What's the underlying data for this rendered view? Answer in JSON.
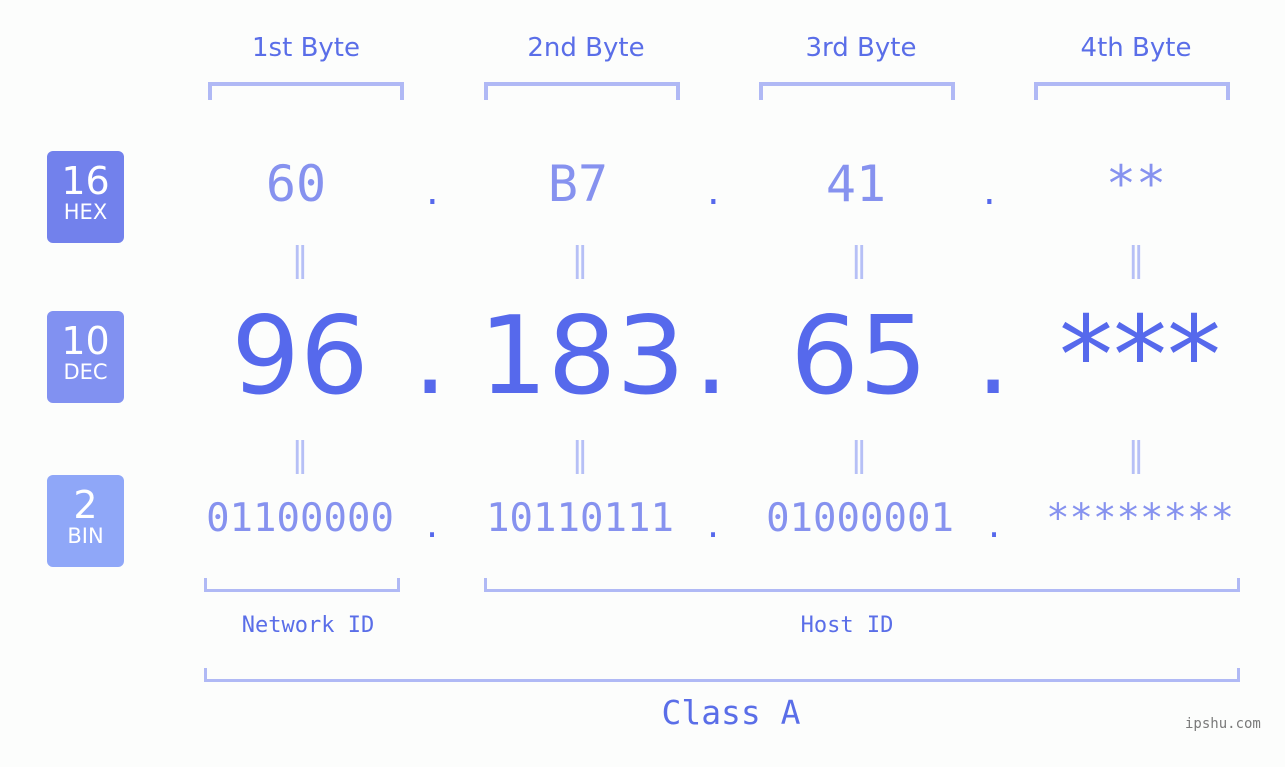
{
  "headers": [
    "1st Byte",
    "2nd Byte",
    "3rd Byte",
    "4th Byte"
  ],
  "badges": [
    {
      "num": "16",
      "label": "HEX",
      "color": "#7281ec"
    },
    {
      "num": "10",
      "label": "DEC",
      "color": "#8191f1"
    },
    {
      "num": "2",
      "label": "BIN",
      "color": "#8fa7f8"
    }
  ],
  "hex": [
    "60",
    "B7",
    "41",
    "**"
  ],
  "dec": [
    "96",
    "183",
    "65",
    "***"
  ],
  "bin": [
    "01100000",
    "10110111",
    "01000001",
    "********"
  ],
  "separator": ".",
  "equals": "=",
  "network_id_label": "Network ID",
  "host_id_label": "Host ID",
  "class_label": "Class A",
  "watermark": "ipshu.com"
}
